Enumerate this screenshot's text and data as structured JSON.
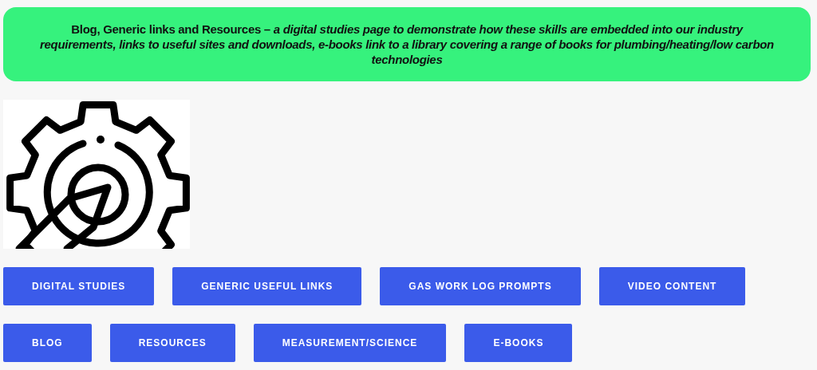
{
  "banner": {
    "text": "**Blog, Generic links and Resources** – *a digital studies page to demonstrate how these skills are embedded into our industry requirements, links to useful sites and downloads, e-books link to a library covering a range of books for plumbing/heating/low carbon technologies*"
  },
  "button_rows": [
    [
      "DIGITAL STUDIES",
      "GENERIC USEFUL LINKS",
      "GAS WORK LOG PROMPTS",
      "VIDEO CONTENT"
    ],
    [
      "BLOG",
      "RESOURCES",
      "MEASUREMENT/SCIENCE",
      "E-BOOKS"
    ]
  ]
}
